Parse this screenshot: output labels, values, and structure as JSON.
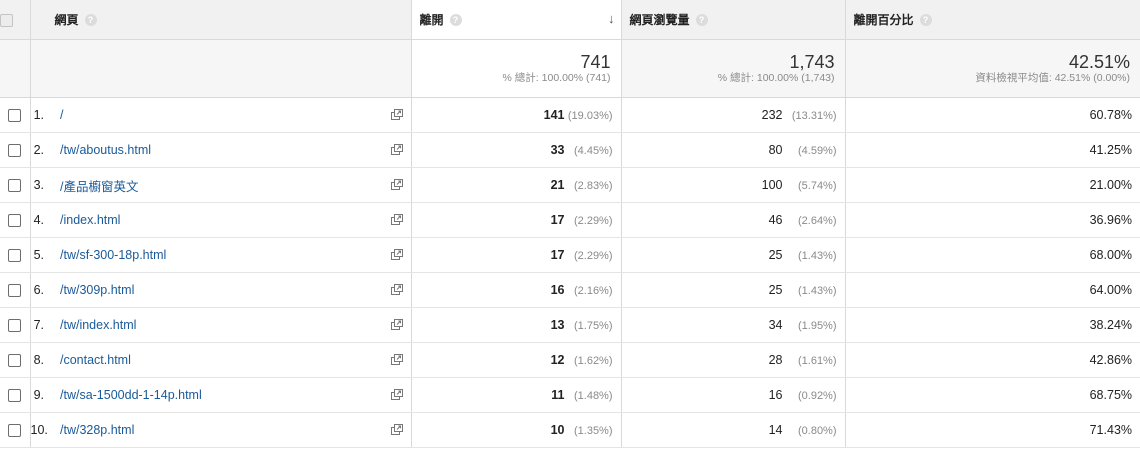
{
  "header": {
    "page_col": "網頁",
    "exits_col": "離開",
    "pageviews_col": "網頁瀏覽量",
    "exit_pct_col": "離開百分比",
    "help_glyph": "?",
    "sort_glyph": "↓"
  },
  "totals": {
    "exits": "741",
    "exits_sub": "% 總計: 100.00% (741)",
    "pageviews": "1,743",
    "pageviews_sub": "% 總計: 100.00% (1,743)",
    "exit_pct": "42.51%",
    "exit_pct_sub": "資料檢視平均值: 42.51% (0.00%)"
  },
  "rows": [
    {
      "idx": "1.",
      "page": "/",
      "exits": "141",
      "exits_pct": "(19.03%)",
      "pv": "232",
      "pv_pct": "(13.31%)",
      "exit_rate": "60.78%"
    },
    {
      "idx": "2.",
      "page": "/tw/aboutus.html",
      "exits": "33",
      "exits_pct": "(4.45%)",
      "pv": "80",
      "pv_pct": "(4.59%)",
      "exit_rate": "41.25%"
    },
    {
      "idx": "3.",
      "page": "/產品櫥窗英文",
      "exits": "21",
      "exits_pct": "(2.83%)",
      "pv": "100",
      "pv_pct": "(5.74%)",
      "exit_rate": "21.00%"
    },
    {
      "idx": "4.",
      "page": "/index.html",
      "exits": "17",
      "exits_pct": "(2.29%)",
      "pv": "46",
      "pv_pct": "(2.64%)",
      "exit_rate": "36.96%"
    },
    {
      "idx": "5.",
      "page": "/tw/sf-300-18p.html",
      "exits": "17",
      "exits_pct": "(2.29%)",
      "pv": "25",
      "pv_pct": "(1.43%)",
      "exit_rate": "68.00%"
    },
    {
      "idx": "6.",
      "page": "/tw/309p.html",
      "exits": "16",
      "exits_pct": "(2.16%)",
      "pv": "25",
      "pv_pct": "(1.43%)",
      "exit_rate": "64.00%"
    },
    {
      "idx": "7.",
      "page": "/tw/index.html",
      "exits": "13",
      "exits_pct": "(1.75%)",
      "pv": "34",
      "pv_pct": "(1.95%)",
      "exit_rate": "38.24%"
    },
    {
      "idx": "8.",
      "page": "/contact.html",
      "exits": "12",
      "exits_pct": "(1.62%)",
      "pv": "28",
      "pv_pct": "(1.61%)",
      "exit_rate": "42.86%"
    },
    {
      "idx": "9.",
      "page": "/tw/sa-1500dd-1-14p.html",
      "exits": "11",
      "exits_pct": "(1.48%)",
      "pv": "16",
      "pv_pct": "(0.92%)",
      "exit_rate": "68.75%"
    },
    {
      "idx": "10.",
      "page": "/tw/328p.html",
      "exits": "10",
      "exits_pct": "(1.35%)",
      "pv": "14",
      "pv_pct": "(0.80%)",
      "exit_rate": "71.43%"
    }
  ],
  "icons": {
    "help": "help-icon",
    "sort": "sort-descending-arrow-icon",
    "external": "external-link-icon",
    "checkbox": "checkbox"
  },
  "colors": {
    "link": "#1a5a9a",
    "header_bg": "#f1f1f1",
    "muted": "#8a8a8a"
  }
}
